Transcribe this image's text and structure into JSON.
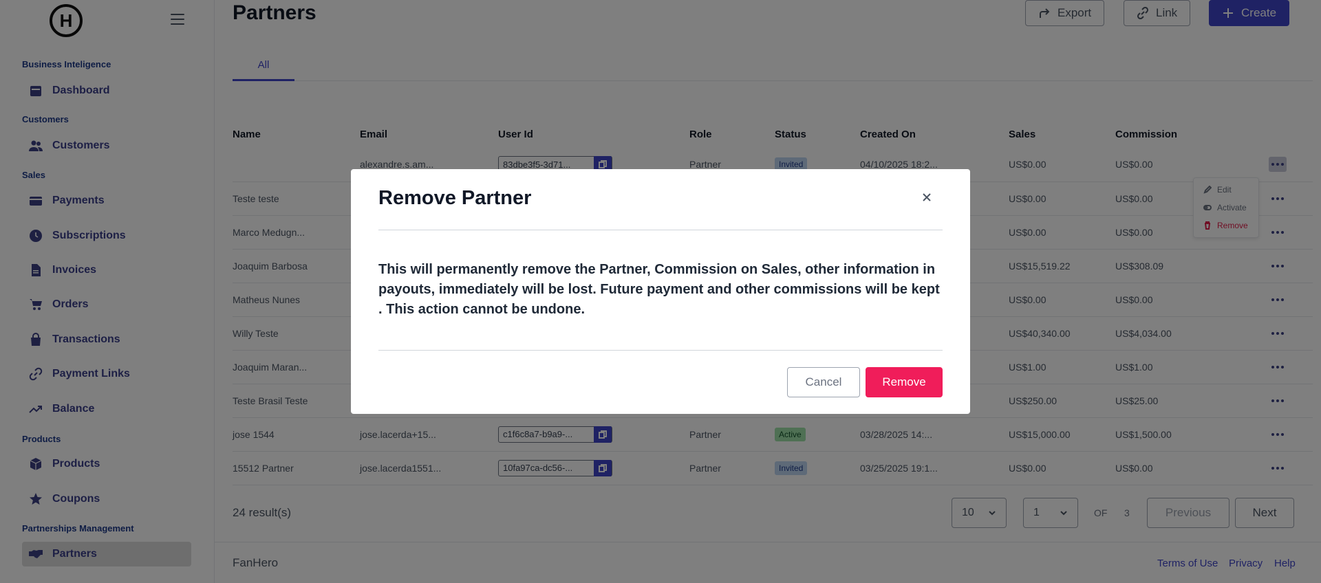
{
  "sidebar": {
    "logo_text": "H",
    "sections": [
      {
        "title": "Business Inteligence",
        "items": [
          {
            "label": "Dashboard",
            "icon": "calendar-icon"
          }
        ]
      },
      {
        "title": "Customers",
        "items": [
          {
            "label": "Customers",
            "icon": "users-icon"
          }
        ]
      },
      {
        "title": "Sales",
        "items": [
          {
            "label": "Payments",
            "icon": "credit-card-icon"
          },
          {
            "label": "Subscriptions",
            "icon": "clock-icon"
          },
          {
            "label": "Invoices",
            "icon": "document-icon"
          },
          {
            "label": "Orders",
            "icon": "cart-icon"
          },
          {
            "label": "Transactions",
            "icon": "bag-icon"
          },
          {
            "label": "Payment Links",
            "icon": "link-icon"
          },
          {
            "label": "Balance",
            "icon": "trend-icon"
          }
        ]
      },
      {
        "title": "Products",
        "items": [
          {
            "label": "Products",
            "icon": "cube-icon"
          },
          {
            "label": "Coupons",
            "icon": "star-icon"
          }
        ]
      },
      {
        "title": "Partnerships Management",
        "items": [
          {
            "label": "Partners",
            "icon": "handshake-icon",
            "active": true
          }
        ]
      }
    ]
  },
  "header": {
    "title": "Partners",
    "export_label": "Export",
    "link_label": "Link",
    "create_label": "Create"
  },
  "tabs": [
    {
      "label": "All",
      "active": true
    }
  ],
  "table": {
    "columns": [
      "Name",
      "Email",
      "User Id",
      "Role",
      "Status",
      "Created On",
      "Sales",
      "Commission"
    ],
    "rows": [
      {
        "name": "",
        "email": "alexandre.s.am...",
        "user_id": "83dbe3f5-3d71...",
        "role": "Partner",
        "status": "Invited",
        "created": "04/10/2025 18:2...",
        "sales": "US$0.00",
        "commission": "US$0.00"
      },
      {
        "name": "Teste teste",
        "email": "",
        "user_id": "",
        "role": "",
        "status": "",
        "created": "",
        "sales": "US$0.00",
        "commission": "US$0.00"
      },
      {
        "name": "Marco Medugn...",
        "email": "",
        "user_id": "",
        "role": "",
        "status": "",
        "created": "",
        "sales": "US$0.00",
        "commission": "US$0.00"
      },
      {
        "name": "Joaquim Barbosa",
        "email": "",
        "user_id": "",
        "role": "",
        "status": "",
        "created": "",
        "sales": "US$15,519.22",
        "commission": "US$308.09"
      },
      {
        "name": "Matheus Nunes",
        "email": "",
        "user_id": "",
        "role": "",
        "status": "",
        "created": "",
        "sales": "US$0.00",
        "commission": "US$0.00"
      },
      {
        "name": "Willy Teste",
        "email": "",
        "user_id": "",
        "role": "",
        "status": "",
        "created": "",
        "sales": "US$40,340.00",
        "commission": "US$4,034.00"
      },
      {
        "name": "Joaquim Maran...",
        "email": "",
        "user_id": "",
        "role": "",
        "status": "",
        "created": "",
        "sales": "US$1.00",
        "commission": "US$1.00"
      },
      {
        "name": "Teste Brasil Teste",
        "email": "",
        "user_id": "",
        "role": "",
        "status": "",
        "created": "",
        "sales": "US$250.00",
        "commission": "US$25.00"
      },
      {
        "name": "jose 1544",
        "email": "jose.lacerda+15...",
        "user_id": "c1f6c8a7-b9a9-...",
        "role": "Partner",
        "status": "Active",
        "created": "03/28/2025 14:...",
        "sales": "US$15,000.00",
        "commission": "US$1,500.00"
      },
      {
        "name": "15512 Partner",
        "email": "jose.lacerda1551...",
        "user_id": "10fa97ca-dc56-...",
        "role": "Partner",
        "status": "Invited",
        "created": "03/25/2025 19:1...",
        "sales": "US$0.00",
        "commission": "US$0.00"
      }
    ]
  },
  "context_menu": {
    "edit": "Edit",
    "activate": "Activate",
    "remove": "Remove"
  },
  "pagination": {
    "results": "24 result(s)",
    "page_size": "10",
    "page": "1",
    "of_label": "OF",
    "total_pages": "3",
    "previous": "Previous",
    "next": "Next"
  },
  "footer": {
    "brand": "FanHero",
    "terms": "Terms of Use",
    "privacy": "Privacy",
    "help": "Help"
  },
  "modal": {
    "title": "Remove Partner",
    "body": "This will permanently remove the Partner, Commission on Sales, other information in payouts, immediately will be lost. Future payment and other commissions will be kept . This action cannot be undone.",
    "cancel": "Cancel",
    "remove": "Remove"
  },
  "colors": {
    "primary": "#3f44c8",
    "danger": "#f01d5a",
    "overlay": "rgba(0,0,0,0.5)"
  }
}
